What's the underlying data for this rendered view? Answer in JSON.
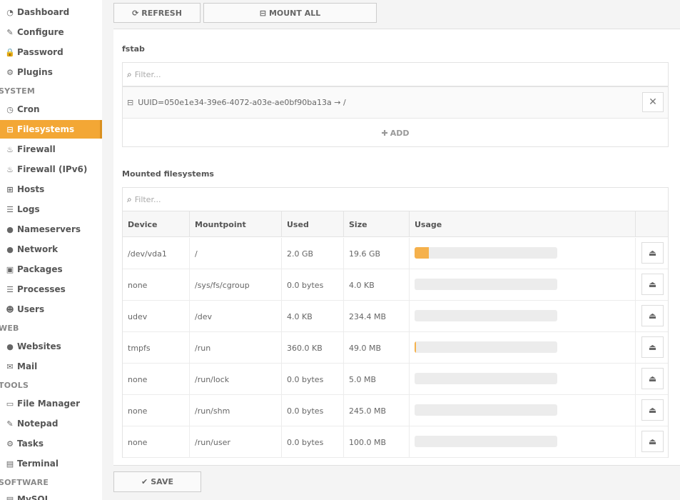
{
  "sidebar": {
    "items": [
      {
        "label": "Dashboard",
        "icon": "dashboard-icon",
        "glyph": "◔"
      },
      {
        "label": "Configure",
        "icon": "wrench-icon",
        "glyph": "✎"
      },
      {
        "label": "Password",
        "icon": "lock-icon",
        "glyph": "🔒"
      },
      {
        "label": "Plugins",
        "icon": "gears-icon",
        "glyph": "⚙"
      },
      {
        "label": "Cron",
        "icon": "clock-icon",
        "glyph": "◷"
      },
      {
        "label": "Filesystems",
        "icon": "hdd-icon",
        "glyph": "⊟",
        "active": true
      },
      {
        "label": "Firewall",
        "icon": "fire-icon",
        "glyph": "♨"
      },
      {
        "label": "Firewall (IPv6)",
        "icon": "fire-icon",
        "glyph": "♨"
      },
      {
        "label": "Hosts",
        "icon": "sitemap-icon",
        "glyph": "⊞"
      },
      {
        "label": "Logs",
        "icon": "list-icon",
        "glyph": "☰"
      },
      {
        "label": "Nameservers",
        "icon": "globe-icon",
        "glyph": "●"
      },
      {
        "label": "Network",
        "icon": "globe-icon",
        "glyph": "●"
      },
      {
        "label": "Packages",
        "icon": "gift-icon",
        "glyph": "▣"
      },
      {
        "label": "Processes",
        "icon": "list-icon",
        "glyph": "☰"
      },
      {
        "label": "Users",
        "icon": "users-icon",
        "glyph": "☻"
      },
      {
        "label": "Websites",
        "icon": "globe-icon",
        "glyph": "●"
      },
      {
        "label": "Mail",
        "icon": "envelope-icon",
        "glyph": "✉"
      },
      {
        "label": "File Manager",
        "icon": "folder-open-icon",
        "glyph": "▭"
      },
      {
        "label": "Notepad",
        "icon": "edit-icon",
        "glyph": "✎"
      },
      {
        "label": "Tasks",
        "icon": "gear-icon",
        "glyph": "⚙"
      },
      {
        "label": "Terminal",
        "icon": "terminal-icon",
        "glyph": "▤"
      }
    ],
    "sections": {
      "system": "SYSTEM",
      "web": "WEB",
      "tools": "TOOLS",
      "software": "SOFTWARE"
    },
    "partial_item": "MySQL"
  },
  "toolbar": {
    "refresh_label": "REFRESH",
    "mount_all_label": "MOUNT ALL"
  },
  "fstab": {
    "title": "fstab",
    "filter_placeholder": "Filter...",
    "entry": "UUID=050e1e34-39e6-4072-a03e-ae0bf90ba13a → /",
    "add_label": "ADD"
  },
  "mounted": {
    "title": "Mounted filesystems",
    "filter_placeholder": "Filter...",
    "columns": [
      "Device",
      "Mountpoint",
      "Used",
      "Size",
      "Usage"
    ],
    "rows": [
      {
        "device": "/dev/vda1",
        "mountpoint": "/",
        "used": "2.0 GB",
        "size": "19.6 GB",
        "usage": 0.1
      },
      {
        "device": "none",
        "mountpoint": "/sys/fs/cgroup",
        "used": "0.0 bytes",
        "size": "4.0 KB",
        "usage": 0
      },
      {
        "device": "udev",
        "mountpoint": "/dev",
        "used": "4.0 KB",
        "size": "234.4 MB",
        "usage": 0
      },
      {
        "device": "tmpfs",
        "mountpoint": "/run",
        "used": "360.0 KB",
        "size": "49.0 MB",
        "usage": 0.007
      },
      {
        "device": "none",
        "mountpoint": "/run/lock",
        "used": "0.0 bytes",
        "size": "5.0 MB",
        "usage": 0
      },
      {
        "device": "none",
        "mountpoint": "/run/shm",
        "used": "0.0 bytes",
        "size": "245.0 MB",
        "usage": 0
      },
      {
        "device": "none",
        "mountpoint": "/run/user",
        "used": "0.0 bytes",
        "size": "100.0 MB",
        "usage": 0
      }
    ]
  },
  "footer": {
    "save_label": "SAVE"
  },
  "colors": {
    "accent": "#f3a735",
    "usage_bar": "#f5b14c"
  }
}
